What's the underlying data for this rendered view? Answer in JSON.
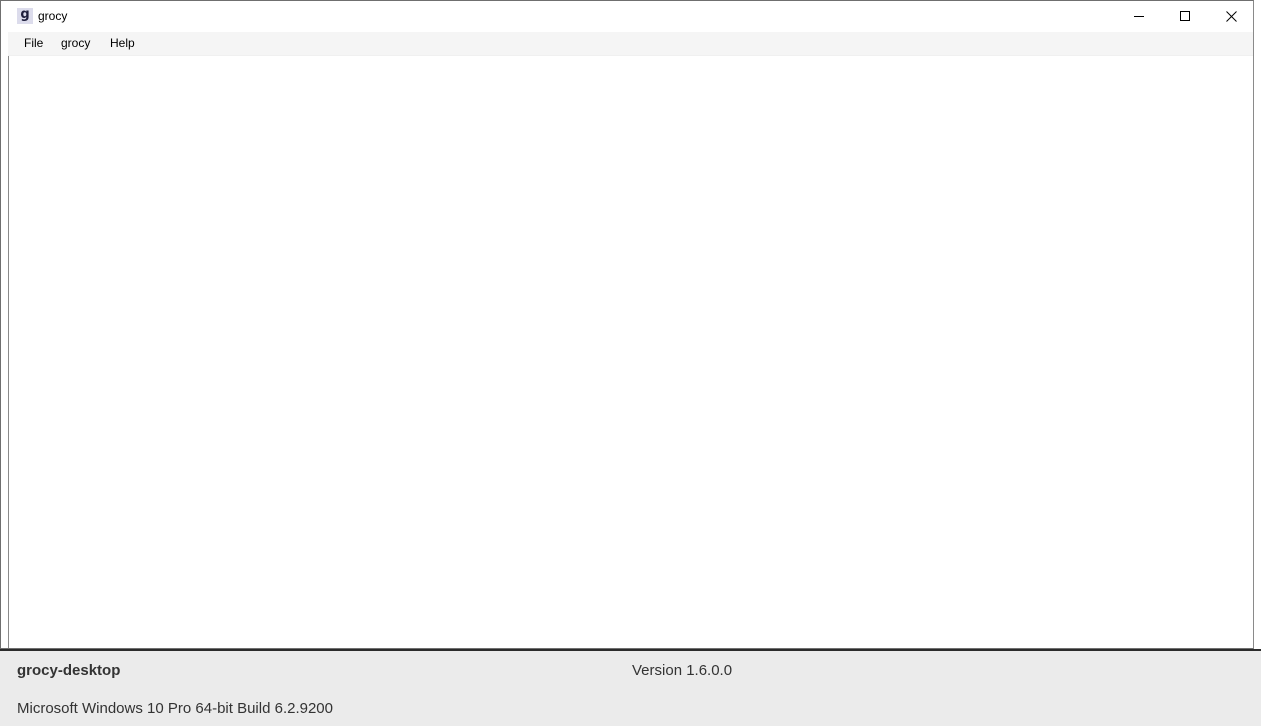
{
  "window": {
    "title": "grocy",
    "icon_letter": "g",
    "controls": {
      "minimize": "minimize-icon",
      "maximize": "maximize-icon",
      "close": "close-icon"
    }
  },
  "menubar": {
    "items": [
      {
        "label": "File"
      },
      {
        "label": "grocy"
      },
      {
        "label": "Help"
      }
    ]
  },
  "footer": {
    "app_name": "grocy-desktop",
    "version": "Version 1.6.0.0",
    "os": "Microsoft Windows 10 Pro 64-bit Build 6.2.9200"
  },
  "colors": {
    "footer_bg": "#ebebeb",
    "menubar_bg": "#f5f5f5",
    "icon_bg": "#dcdcec"
  }
}
